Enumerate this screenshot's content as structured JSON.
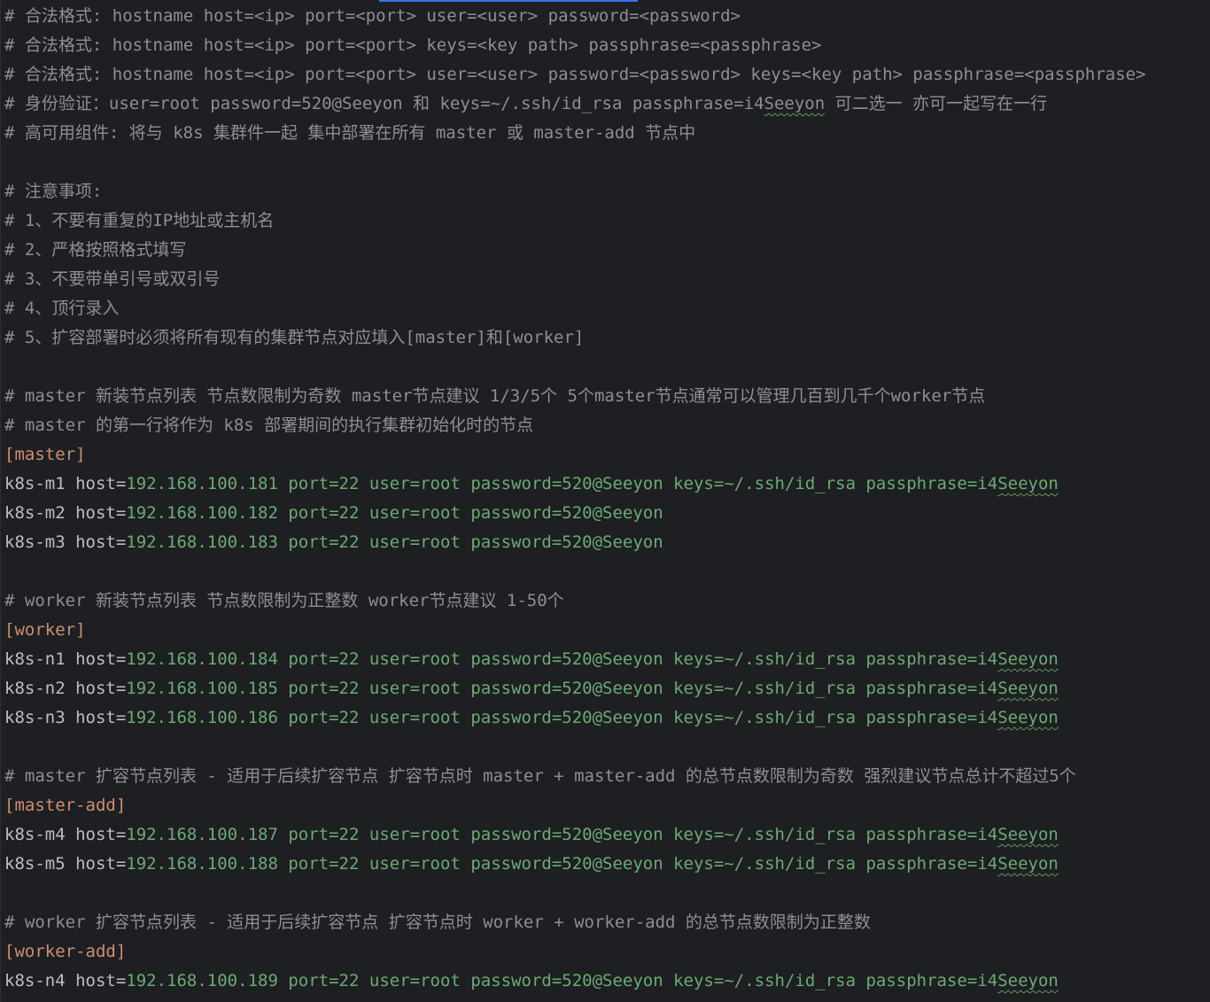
{
  "editor": {
    "comments_header": [
      "# 合法格式: hostname host=<ip> port=<port> user=<user> password=<password>",
      "# 合法格式: hostname host=<ip> port=<port> keys=<key path> passphrase=<passphrase>",
      "# 合法格式: hostname host=<ip> port=<port> user=<user> password=<password> keys=<key path> passphrase=<passphrase>",
      "# 身份验证：user=root password=520@Seeyon 和 keys=~/.ssh/id_rsa passphrase=i4",
      "# 高可用组件: 将与 k8s 集群件一起 集中部署在所有 master 或 master-add 节点中"
    ],
    "auth_line_tail": {
      "typo_word": "Seeyon",
      "rest": " 可二选一 亦可一起写在一行"
    },
    "notes": [
      "# 注意事项:",
      "# 1、不要有重复的IP地址或主机名",
      "# 2、严格按照格式填写",
      "# 3、不要带单引号或双引号",
      "# 4、顶行录入",
      "# 5、扩容部署时必须将所有现有的集群节点对应填入[master]和[worker]"
    ],
    "master_comments": [
      "# master 新装节点列表 节点数限制为奇数 master节点建议 1/3/5个 5个master节点通常可以管理几百到几千个worker节点",
      "# master 的第一行将作为 k8s 部署期间的执行集群初始化时的节点"
    ],
    "master_section": "[master]",
    "master_nodes": [
      {
        "name": "k8s-m1",
        "ip": "192.168.100.181",
        "port": "22",
        "user": "root",
        "password": "520@Seeyon",
        "keys": "~/.ssh/id_rsa",
        "passphrase_prefix": "i4",
        "passphrase_word": "Seeyon"
      },
      {
        "name": "k8s-m2",
        "ip": "192.168.100.182",
        "port": "22",
        "user": "root",
        "password": "520@Seeyon"
      },
      {
        "name": "k8s-m3",
        "ip": "192.168.100.183",
        "port": "22",
        "user": "root",
        "password": "520@Seeyon"
      }
    ],
    "worker_comment": "# worker 新装节点列表 节点数限制为正整数 worker节点建议 1-50个",
    "worker_section": "[worker]",
    "worker_nodes": [
      {
        "name": "k8s-n1",
        "ip": "192.168.100.184",
        "port": "22",
        "user": "root",
        "password": "520@Seeyon",
        "keys": "~/.ssh/id_rsa",
        "passphrase_prefix": "i4",
        "passphrase_word": "Seeyon"
      },
      {
        "name": "k8s-n2",
        "ip": "192.168.100.185",
        "port": "22",
        "user": "root",
        "password": "520@Seeyon",
        "keys": "~/.ssh/id_rsa",
        "passphrase_prefix": "i4",
        "passphrase_word": "Seeyon"
      },
      {
        "name": "k8s-n3",
        "ip": "192.168.100.186",
        "port": "22",
        "user": "root",
        "password": "520@Seeyon",
        "keys": "~/.ssh/id_rsa",
        "passphrase_prefix": "i4",
        "passphrase_word": "Seeyon"
      }
    ],
    "master_add_comment": "# master 扩容节点列表 - 适用于后续扩容节点 扩容节点时 master + master-add 的总节点数限制为奇数 强烈建议节点总计不超过5个",
    "master_add_section": "[master-add]",
    "master_add_nodes": [
      {
        "name": "k8s-m4",
        "ip": "192.168.100.187",
        "port": "22",
        "user": "root",
        "password": "520@Seeyon",
        "keys": "~/.ssh/id_rsa",
        "passphrase_prefix": "i4",
        "passphrase_word": "Seeyon"
      },
      {
        "name": "k8s-m5",
        "ip": "192.168.100.188",
        "port": "22",
        "user": "root",
        "password": "520@Seeyon",
        "keys": "~/.ssh/id_rsa",
        "passphrase_prefix": "i4",
        "passphrase_word": "Seeyon"
      }
    ],
    "worker_add_comment": "# worker 扩容节点列表 - 适用于后续扩容节点 扩容节点时 worker + worker-add 的总节点数限制为正整数",
    "worker_add_section": "[worker-add]",
    "worker_add_nodes": [
      {
        "name": "k8s-n4",
        "ip": "192.168.100.189",
        "port": "22",
        "user": "root",
        "password": "520@Seeyon",
        "keys": "~/.ssh/id_rsa",
        "passphrase_prefix": "i4",
        "passphrase_word": "Seeyon"
      }
    ],
    "labels": {
      "host": "host=",
      "port": "port=",
      "user": "user=",
      "password": "password=",
      "keys": "keys=",
      "passphrase": "passphrase="
    }
  },
  "colors": {
    "background": "#1e1f22",
    "comment": "#8c8f96",
    "section": "#cf8e6d",
    "value": "#6aab73",
    "text": "#bcbec4",
    "tab_indicator": "#3574f0"
  }
}
